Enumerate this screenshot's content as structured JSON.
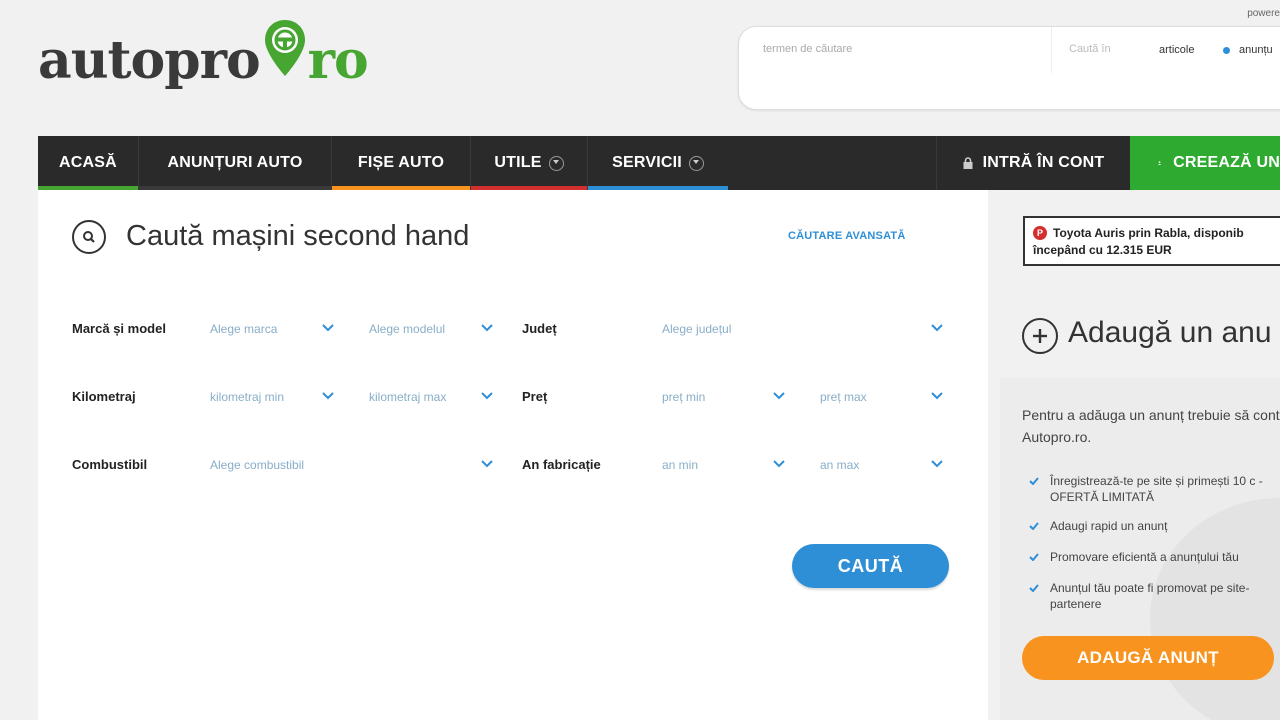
{
  "header": {
    "logo_main": "autopro",
    "logo_suffix": "ro",
    "powered": "powere",
    "search": {
      "placeholder": "termen de căutare",
      "search_in": "Caută în",
      "option_articles": "articole",
      "option_ads": "anunțu"
    }
  },
  "nav": {
    "items": [
      {
        "label": "ACASĂ",
        "color": "#47a632"
      },
      {
        "label": "ANUNȚURI AUTO",
        "color": "#3a3a3a"
      },
      {
        "label": "FIȘE AUTO",
        "color": "#f7931e"
      },
      {
        "label": "UTILE",
        "color": "#d32f2f"
      },
      {
        "label": "SERVICII",
        "color": "#2f8fd6"
      }
    ],
    "login": "INTRĂ ÎN CONT",
    "register": "CREEAZĂ UN"
  },
  "search_form": {
    "title": "Caută mașini second hand",
    "advanced": "CĂUTARE AVANSATĂ",
    "brand_label": "Marcă și model",
    "brand_placeholder": "Alege marca",
    "model_placeholder": "Alege modelul",
    "county_label": "Județ",
    "county_placeholder": "Alege județul",
    "km_label": "Kilometraj",
    "km_min": "kilometraj min",
    "km_max": "kilometraj max",
    "price_label": "Preț",
    "price_min": "preț min",
    "price_max": "preț max",
    "fuel_label": "Combustibil",
    "fuel_placeholder": "Alege combustibil",
    "year_label": "An fabricație",
    "year_min": "an min",
    "year_max": "an max",
    "submit": "CAUTĂ"
  },
  "sidebar": {
    "promo_line1": "Toyota Auris prin Rabla, disponib",
    "promo_line2": "începând cu 12.315 EUR",
    "add_title": "Adaugă un anu",
    "intro": "Pentru a adăuga un anunț trebuie să cont Autopro.ro.",
    "benefits": [
      "Înregistrează-te pe site și primești 10 c - OFERTĂ LIMITATĂ",
      "Adaugi rapid un anunț",
      "Promovare eficientă a anunțului tău",
      "Anunțul tău poate fi promovat pe site- partenere"
    ],
    "add_button": "ADAUGĂ ANUNȚ"
  },
  "colors": {
    "brand_green": "#47a632",
    "accent_blue": "#2f8fd6",
    "accent_orange": "#f7931e",
    "nav_bg": "#2a2a2a"
  }
}
